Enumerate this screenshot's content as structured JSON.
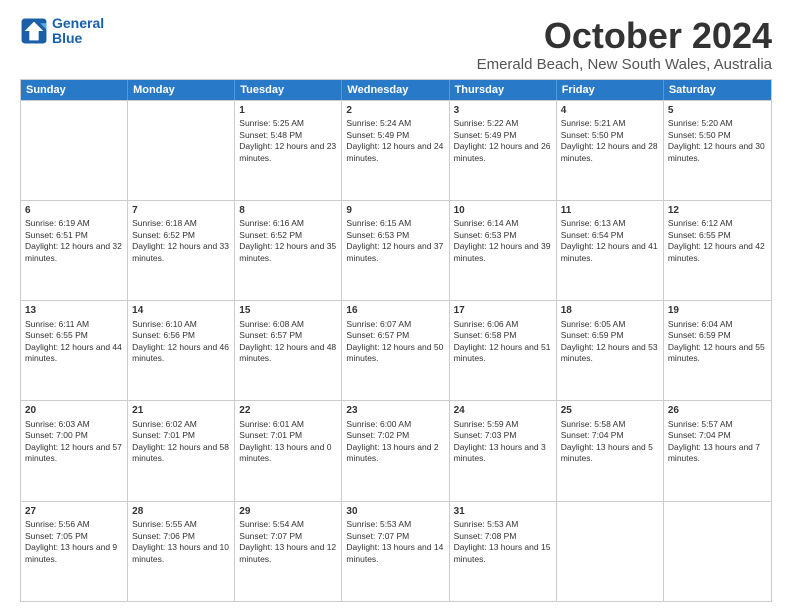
{
  "logo": {
    "line1": "General",
    "line2": "Blue"
  },
  "title": "October 2024",
  "location": "Emerald Beach, New South Wales, Australia",
  "weekdays": [
    "Sunday",
    "Monday",
    "Tuesday",
    "Wednesday",
    "Thursday",
    "Friday",
    "Saturday"
  ],
  "rows": [
    [
      {
        "day": "",
        "sunrise": "",
        "sunset": "",
        "daylight": ""
      },
      {
        "day": "",
        "sunrise": "",
        "sunset": "",
        "daylight": ""
      },
      {
        "day": "1",
        "sunrise": "Sunrise: 5:25 AM",
        "sunset": "Sunset: 5:48 PM",
        "daylight": "Daylight: 12 hours and 23 minutes."
      },
      {
        "day": "2",
        "sunrise": "Sunrise: 5:24 AM",
        "sunset": "Sunset: 5:49 PM",
        "daylight": "Daylight: 12 hours and 24 minutes."
      },
      {
        "day": "3",
        "sunrise": "Sunrise: 5:22 AM",
        "sunset": "Sunset: 5:49 PM",
        "daylight": "Daylight: 12 hours and 26 minutes."
      },
      {
        "day": "4",
        "sunrise": "Sunrise: 5:21 AM",
        "sunset": "Sunset: 5:50 PM",
        "daylight": "Daylight: 12 hours and 28 minutes."
      },
      {
        "day": "5",
        "sunrise": "Sunrise: 5:20 AM",
        "sunset": "Sunset: 5:50 PM",
        "daylight": "Daylight: 12 hours and 30 minutes."
      }
    ],
    [
      {
        "day": "6",
        "sunrise": "Sunrise: 6:19 AM",
        "sunset": "Sunset: 6:51 PM",
        "daylight": "Daylight: 12 hours and 32 minutes."
      },
      {
        "day": "7",
        "sunrise": "Sunrise: 6:18 AM",
        "sunset": "Sunset: 6:52 PM",
        "daylight": "Daylight: 12 hours and 33 minutes."
      },
      {
        "day": "8",
        "sunrise": "Sunrise: 6:16 AM",
        "sunset": "Sunset: 6:52 PM",
        "daylight": "Daylight: 12 hours and 35 minutes."
      },
      {
        "day": "9",
        "sunrise": "Sunrise: 6:15 AM",
        "sunset": "Sunset: 6:53 PM",
        "daylight": "Daylight: 12 hours and 37 minutes."
      },
      {
        "day": "10",
        "sunrise": "Sunrise: 6:14 AM",
        "sunset": "Sunset: 6:53 PM",
        "daylight": "Daylight: 12 hours and 39 minutes."
      },
      {
        "day": "11",
        "sunrise": "Sunrise: 6:13 AM",
        "sunset": "Sunset: 6:54 PM",
        "daylight": "Daylight: 12 hours and 41 minutes."
      },
      {
        "day": "12",
        "sunrise": "Sunrise: 6:12 AM",
        "sunset": "Sunset: 6:55 PM",
        "daylight": "Daylight: 12 hours and 42 minutes."
      }
    ],
    [
      {
        "day": "13",
        "sunrise": "Sunrise: 6:11 AM",
        "sunset": "Sunset: 6:55 PM",
        "daylight": "Daylight: 12 hours and 44 minutes."
      },
      {
        "day": "14",
        "sunrise": "Sunrise: 6:10 AM",
        "sunset": "Sunset: 6:56 PM",
        "daylight": "Daylight: 12 hours and 46 minutes."
      },
      {
        "day": "15",
        "sunrise": "Sunrise: 6:08 AM",
        "sunset": "Sunset: 6:57 PM",
        "daylight": "Daylight: 12 hours and 48 minutes."
      },
      {
        "day": "16",
        "sunrise": "Sunrise: 6:07 AM",
        "sunset": "Sunset: 6:57 PM",
        "daylight": "Daylight: 12 hours and 50 minutes."
      },
      {
        "day": "17",
        "sunrise": "Sunrise: 6:06 AM",
        "sunset": "Sunset: 6:58 PM",
        "daylight": "Daylight: 12 hours and 51 minutes."
      },
      {
        "day": "18",
        "sunrise": "Sunrise: 6:05 AM",
        "sunset": "Sunset: 6:59 PM",
        "daylight": "Daylight: 12 hours and 53 minutes."
      },
      {
        "day": "19",
        "sunrise": "Sunrise: 6:04 AM",
        "sunset": "Sunset: 6:59 PM",
        "daylight": "Daylight: 12 hours and 55 minutes."
      }
    ],
    [
      {
        "day": "20",
        "sunrise": "Sunrise: 6:03 AM",
        "sunset": "Sunset: 7:00 PM",
        "daylight": "Daylight: 12 hours and 57 minutes."
      },
      {
        "day": "21",
        "sunrise": "Sunrise: 6:02 AM",
        "sunset": "Sunset: 7:01 PM",
        "daylight": "Daylight: 12 hours and 58 minutes."
      },
      {
        "day": "22",
        "sunrise": "Sunrise: 6:01 AM",
        "sunset": "Sunset: 7:01 PM",
        "daylight": "Daylight: 13 hours and 0 minutes."
      },
      {
        "day": "23",
        "sunrise": "Sunrise: 6:00 AM",
        "sunset": "Sunset: 7:02 PM",
        "daylight": "Daylight: 13 hours and 2 minutes."
      },
      {
        "day": "24",
        "sunrise": "Sunrise: 5:59 AM",
        "sunset": "Sunset: 7:03 PM",
        "daylight": "Daylight: 13 hours and 3 minutes."
      },
      {
        "day": "25",
        "sunrise": "Sunrise: 5:58 AM",
        "sunset": "Sunset: 7:04 PM",
        "daylight": "Daylight: 13 hours and 5 minutes."
      },
      {
        "day": "26",
        "sunrise": "Sunrise: 5:57 AM",
        "sunset": "Sunset: 7:04 PM",
        "daylight": "Daylight: 13 hours and 7 minutes."
      }
    ],
    [
      {
        "day": "27",
        "sunrise": "Sunrise: 5:56 AM",
        "sunset": "Sunset: 7:05 PM",
        "daylight": "Daylight: 13 hours and 9 minutes."
      },
      {
        "day": "28",
        "sunrise": "Sunrise: 5:55 AM",
        "sunset": "Sunset: 7:06 PM",
        "daylight": "Daylight: 13 hours and 10 minutes."
      },
      {
        "day": "29",
        "sunrise": "Sunrise: 5:54 AM",
        "sunset": "Sunset: 7:07 PM",
        "daylight": "Daylight: 13 hours and 12 minutes."
      },
      {
        "day": "30",
        "sunrise": "Sunrise: 5:53 AM",
        "sunset": "Sunset: 7:07 PM",
        "daylight": "Daylight: 13 hours and 14 minutes."
      },
      {
        "day": "31",
        "sunrise": "Sunrise: 5:53 AM",
        "sunset": "Sunset: 7:08 PM",
        "daylight": "Daylight: 13 hours and 15 minutes."
      },
      {
        "day": "",
        "sunrise": "",
        "sunset": "",
        "daylight": ""
      },
      {
        "day": "",
        "sunrise": "",
        "sunset": "",
        "daylight": ""
      }
    ]
  ]
}
